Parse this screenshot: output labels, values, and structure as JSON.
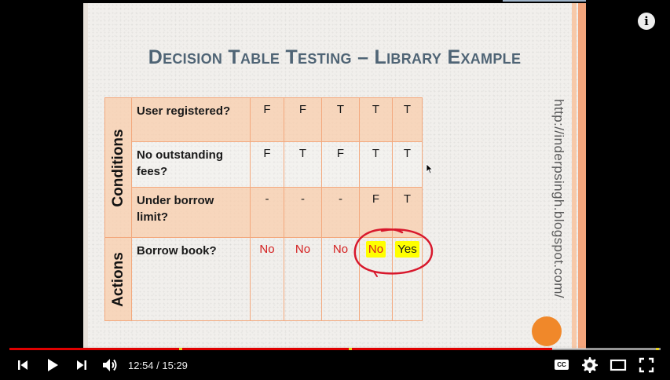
{
  "slide": {
    "title": "Decision Table Testing – Library Example",
    "url_text": "http://inderpsingh.blogspot.com/",
    "groups": {
      "conditions": "Conditions",
      "actions": "Actions"
    },
    "rows": [
      {
        "label": "User registered?",
        "values": [
          "F",
          "F",
          "T",
          "T",
          "T"
        ]
      },
      {
        "label": "No outstanding fees?",
        "values": [
          "F",
          "T",
          "F",
          "T",
          "T"
        ]
      },
      {
        "label": "Under borrow limit?",
        "values": [
          "-",
          "-",
          "-",
          "F",
          "T"
        ]
      },
      {
        "label": "Borrow  book?",
        "values": [
          "No",
          "No",
          "No",
          "No",
          "Yes"
        ]
      }
    ]
  },
  "player": {
    "time_current": "12:54",
    "time_total": "15:29",
    "time_display": "12:54 / 15:29",
    "progress_fraction": 0.833,
    "colors": {
      "played": "#e00000",
      "chapter_marker": "#e8d21a",
      "highlight": "#ffff00",
      "action_red": "#d42020"
    },
    "icons": [
      "previous-icon",
      "play-icon",
      "next-icon",
      "volume-icon",
      "captions-icon",
      "settings-icon",
      "theater-mode-icon",
      "fullscreen-icon",
      "info-icon"
    ],
    "info_glyph": "i",
    "captions_label": "CC"
  }
}
